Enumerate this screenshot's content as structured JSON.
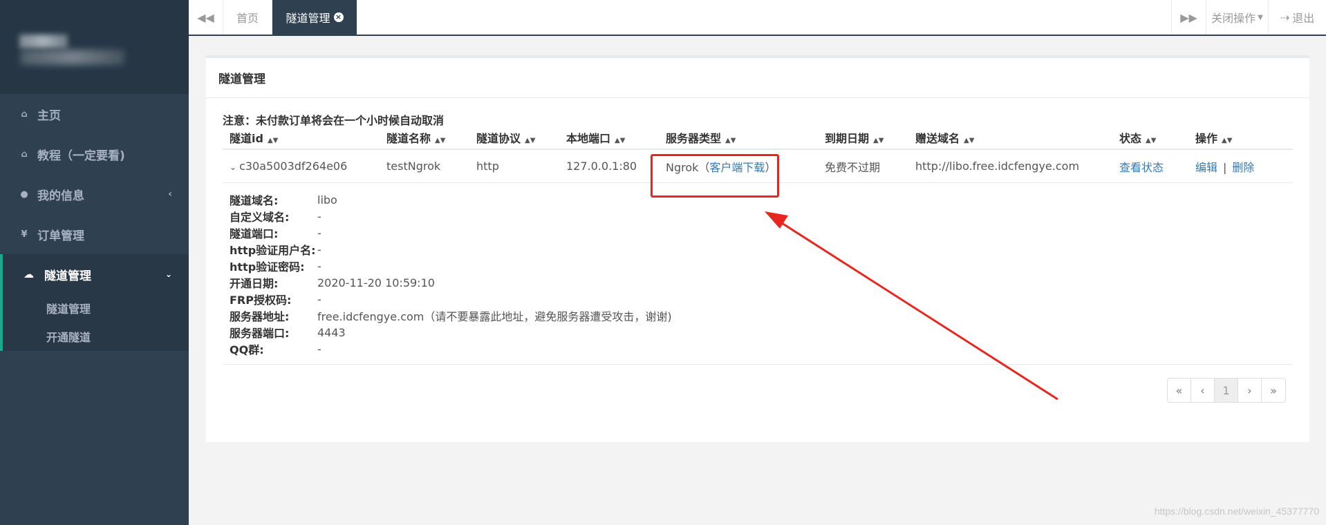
{
  "sidebar": {
    "items": [
      {
        "label": "主页",
        "icon": "home-icon"
      },
      {
        "label": "教程（一定要看)",
        "icon": "home-icon"
      },
      {
        "label": "我的信息",
        "icon": "user-icon"
      },
      {
        "label": "订单管理",
        "icon": "yen-icon"
      }
    ],
    "active": {
      "label": "隧道管理",
      "icon": "cloud-icon",
      "children": [
        "隧道管理",
        "开通隧道"
      ]
    }
  },
  "topbar": {
    "tabs": [
      "首页",
      "隧道管理"
    ],
    "close_ops": "关闭操作",
    "logout": "退出"
  },
  "panel": {
    "title": "隧道管理",
    "notice": "注意：未付款订单将会在一个小时候自动取消",
    "columns": [
      "隧道id",
      "隧道名称",
      "隧道协议",
      "本地端口",
      "服务器类型",
      "到期日期",
      "赠送域名",
      "状态",
      "操作"
    ],
    "row": {
      "id": "c30a5003df264e06",
      "name": "testNgrok",
      "protocol": "http",
      "local_port": "127.0.0.1:80",
      "server_type": "Ngrok（",
      "client_download": "客户端下载",
      "server_type_end": "）",
      "expire": "免费不过期",
      "domain": "http://libo.free.idcfengye.com",
      "status": "查看状态",
      "edit": "编辑",
      "sep": "|",
      "delete": "删除"
    },
    "details": [
      {
        "k": "隧道域名:",
        "v": "libo"
      },
      {
        "k": "自定义域名:",
        "v": "-"
      },
      {
        "k": "隧道端口:",
        "v": "-"
      },
      {
        "k": "http验证用户名:",
        "v": "-"
      },
      {
        "k": "http验证密码:",
        "v": "-"
      },
      {
        "k": "开通日期:",
        "v": "2020-11-20 10:59:10"
      },
      {
        "k": "FRP授权码:",
        "v": "-"
      },
      {
        "k": "服务器地址:",
        "v": "free.idcfengye.com（请不要暴露此地址，避免服务器遭受攻击，谢谢)"
      },
      {
        "k": "服务器端口:",
        "v": "4443"
      },
      {
        "k": "QQ群:",
        "v": "-"
      }
    ],
    "pager": [
      "«",
      "‹",
      "1",
      "›",
      "»"
    ]
  },
  "watermark": "https://blog.csdn.net/weixin_45377770",
  "colors": {
    "sidebar": "#2f4050",
    "accent": "#19aa8d",
    "link": "#337ab7",
    "annotation": "#e8261e"
  }
}
